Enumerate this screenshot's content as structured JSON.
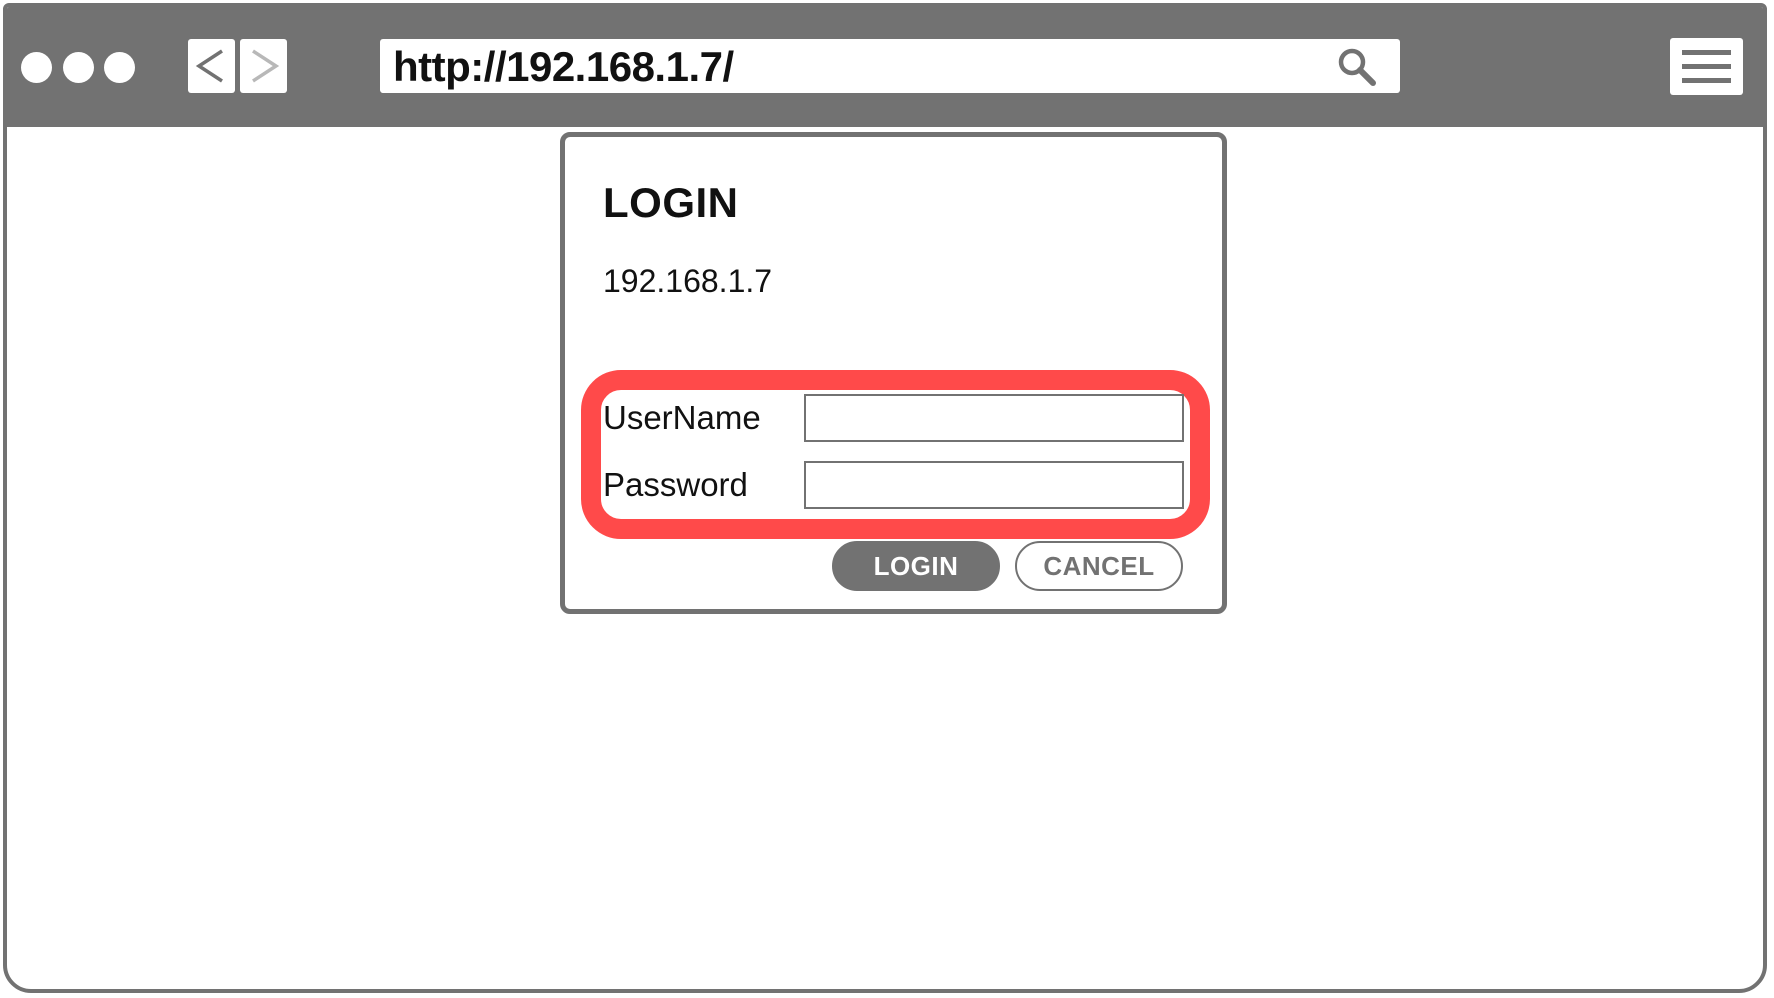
{
  "browser": {
    "url": "http://192.168.1.7/",
    "window_controls": [
      "dot",
      "dot",
      "dot"
    ],
    "nav": {
      "back_icon": "chevron-left-icon",
      "forward_icon": "chevron-right-icon"
    },
    "search_icon": "search-icon",
    "menu_icon": "hamburger-menu-icon"
  },
  "dialog": {
    "title": "LOGIN",
    "host": "192.168.1.7",
    "fields": [
      {
        "label": "UserName",
        "value": "",
        "placeholder": ""
      },
      {
        "label": "Password",
        "value": "",
        "placeholder": ""
      }
    ],
    "login_label": "LOGIN",
    "cancel_label": "CANCEL"
  },
  "colors": {
    "chrome": "#727272",
    "highlight": "#ff4a4a",
    "background": "#ffffff",
    "text": "#111111"
  }
}
